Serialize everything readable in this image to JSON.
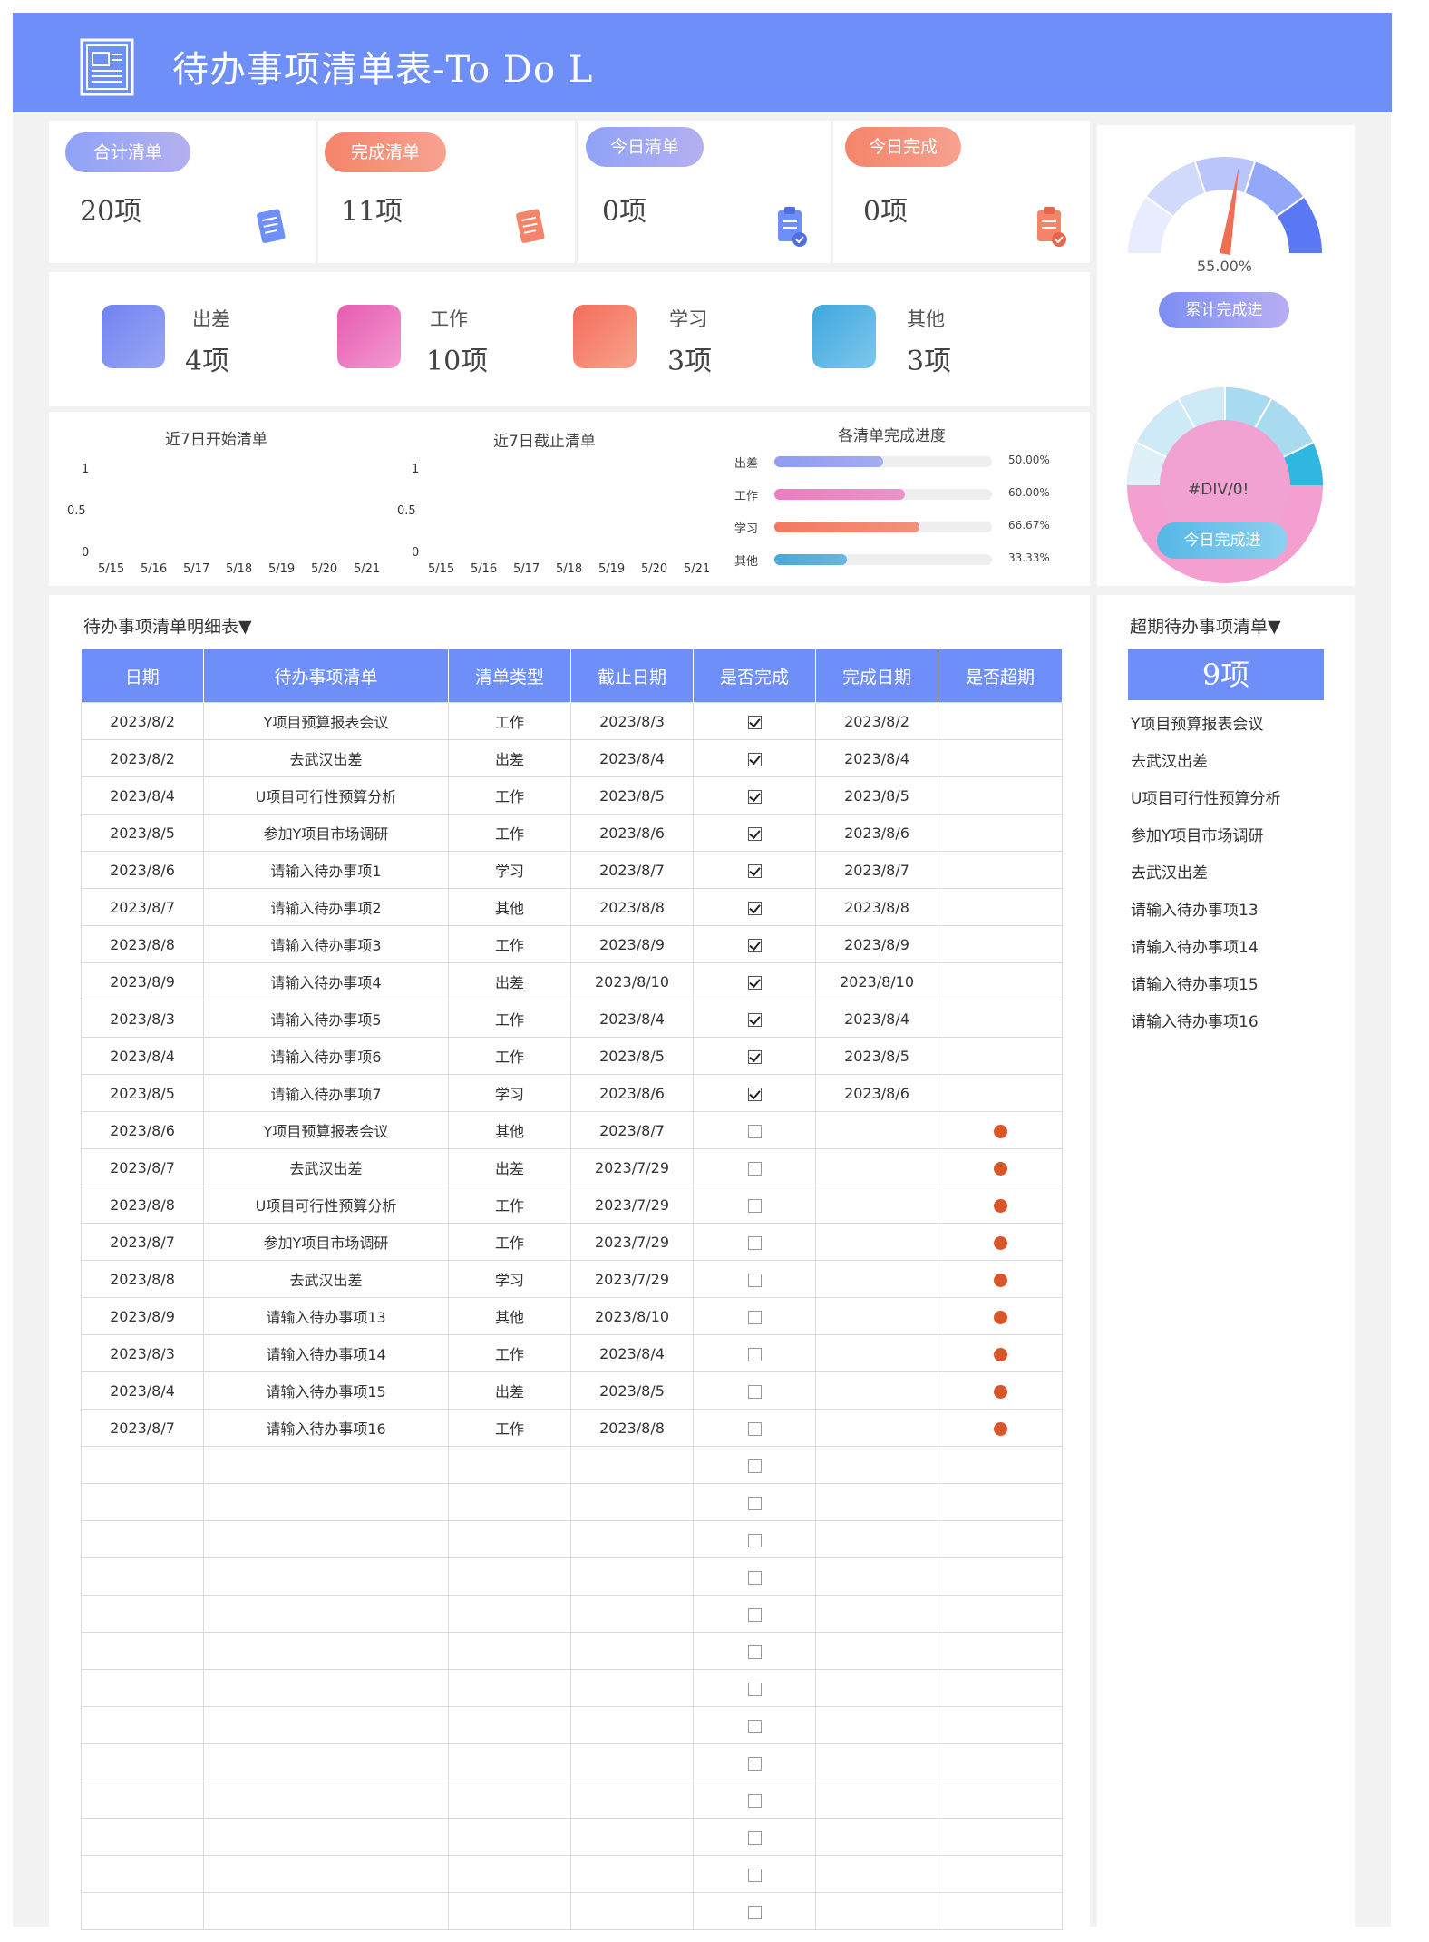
{
  "header": {
    "title": "待办事项清单表-To Do L"
  },
  "summary": [
    {
      "label": "合计清单",
      "value": "20项",
      "color": "#8fa2f7"
    },
    {
      "label": "完成清单",
      "value": "11项",
      "color": "#f4846a"
    },
    {
      "label": "今日清单",
      "value": "0项",
      "color": "#8fa2f7"
    },
    {
      "label": "今日完成",
      "value": "0项",
      "color": "#f4846a"
    }
  ],
  "categories": [
    {
      "label": "出差",
      "value": "4项",
      "color": "#7b8cf3"
    },
    {
      "label": "工作",
      "value": "10项",
      "color": "#ee74b9"
    },
    {
      "label": "学习",
      "value": "3项",
      "color": "#f6866a"
    },
    {
      "label": "其他",
      "value": "3项",
      "color": "#4ab1e2"
    }
  ],
  "gauge": {
    "value_text": "55.00%",
    "fraction": 0.55,
    "label": "累计完成进"
  },
  "donut": {
    "value_text": "#DIV/0!",
    "label": "今日完成进"
  },
  "charts": {
    "start": {
      "title": "近7日开始清单",
      "y_ticks": [
        "1",
        "0.5",
        "0"
      ],
      "x_ticks": [
        "5/15",
        "5/16",
        "5/17",
        "5/18",
        "5/19",
        "5/20",
        "5/21"
      ]
    },
    "end": {
      "title": "近7日截止清单",
      "y_ticks": [
        "1",
        "0.5",
        "0"
      ],
      "x_ticks": [
        "5/15",
        "5/16",
        "5/17",
        "5/18",
        "5/19",
        "5/20",
        "5/21"
      ]
    },
    "progress": {
      "title": "各清单完成进度",
      "rows": [
        {
          "label": "出差",
          "pct": 0.5,
          "text": "50.00%",
          "color": "#8f9cf1"
        },
        {
          "label": "工作",
          "pct": 0.6,
          "text": "60.00%",
          "color": "#ec7cc0"
        },
        {
          "label": "学习",
          "pct": 0.6667,
          "text": "66.67%",
          "color": "#f27a5f"
        },
        {
          "label": "其他",
          "pct": 0.3333,
          "text": "33.33%",
          "color": "#4aa6dc"
        }
      ]
    }
  },
  "table": {
    "section_title": "待办事项清单明细表▼",
    "headers": [
      "日期",
      "待办事项清单",
      "清单类型",
      "截止日期",
      "是否完成",
      "完成日期",
      "是否超期"
    ],
    "rows": [
      [
        "2023/8/2",
        "Y项目预算报表会议",
        "工作",
        "2023/8/3",
        "done",
        "2023/8/2",
        ""
      ],
      [
        "2023/8/2",
        "去武汉出差",
        "出差",
        "2023/8/4",
        "done",
        "2023/8/4",
        ""
      ],
      [
        "2023/8/4",
        "U项目可行性预算分析",
        "工作",
        "2023/8/5",
        "done",
        "2023/8/5",
        ""
      ],
      [
        "2023/8/5",
        "参加Y项目市场调研",
        "工作",
        "2023/8/6",
        "done",
        "2023/8/6",
        ""
      ],
      [
        "2023/8/6",
        "请输入待办事项1",
        "学习",
        "2023/8/7",
        "done",
        "2023/8/7",
        ""
      ],
      [
        "2023/8/7",
        "请输入待办事项2",
        "其他",
        "2023/8/8",
        "done",
        "2023/8/8",
        ""
      ],
      [
        "2023/8/8",
        "请输入待办事项3",
        "工作",
        "2023/8/9",
        "done",
        "2023/8/9",
        ""
      ],
      [
        "2023/8/9",
        "请输入待办事项4",
        "出差",
        "2023/8/10",
        "done",
        "2023/8/10",
        ""
      ],
      [
        "2023/8/3",
        "请输入待办事项5",
        "工作",
        "2023/8/4",
        "done",
        "2023/8/4",
        ""
      ],
      [
        "2023/8/4",
        "请输入待办事项6",
        "工作",
        "2023/8/5",
        "done",
        "2023/8/5",
        ""
      ],
      [
        "2023/8/5",
        "请输入待办事项7",
        "学习",
        "2023/8/6",
        "done",
        "2023/8/6",
        ""
      ],
      [
        "2023/8/6",
        "Y项目预算报表会议",
        "其他",
        "2023/8/7",
        "open",
        "",
        "overdue"
      ],
      [
        "2023/8/7",
        "去武汉出差",
        "出差",
        "2023/7/29",
        "open",
        "",
        "overdue"
      ],
      [
        "2023/8/8",
        "U项目可行性预算分析",
        "工作",
        "2023/7/29",
        "open",
        "",
        "overdue"
      ],
      [
        "2023/8/7",
        "参加Y项目市场调研",
        "工作",
        "2023/7/29",
        "open",
        "",
        "overdue"
      ],
      [
        "2023/8/8",
        "去武汉出差",
        "学习",
        "2023/7/29",
        "open",
        "",
        "overdue"
      ],
      [
        "2023/8/9",
        "请输入待办事项13",
        "其他",
        "2023/8/10",
        "open",
        "",
        "overdue"
      ],
      [
        "2023/8/3",
        "请输入待办事项14",
        "工作",
        "2023/8/4",
        "open",
        "",
        "overdue"
      ],
      [
        "2023/8/4",
        "请输入待办事项15",
        "出差",
        "2023/8/5",
        "open",
        "",
        "overdue"
      ],
      [
        "2023/8/7",
        "请输入待办事项16",
        "工作",
        "2023/8/8",
        "open",
        "",
        "overdue"
      ]
    ],
    "empty_rows": 13
  },
  "overdue": {
    "section_title": "超期待办事项清单▼",
    "count": "9项",
    "items": [
      "Y项目预算报表会议",
      "去武汉出差",
      "U项目可行性预算分析",
      "参加Y项目市场调研",
      "去武汉出差",
      "请输入待办事项13",
      "请输入待办事项14",
      "请输入待办事项15",
      "请输入待办事项16"
    ]
  }
}
